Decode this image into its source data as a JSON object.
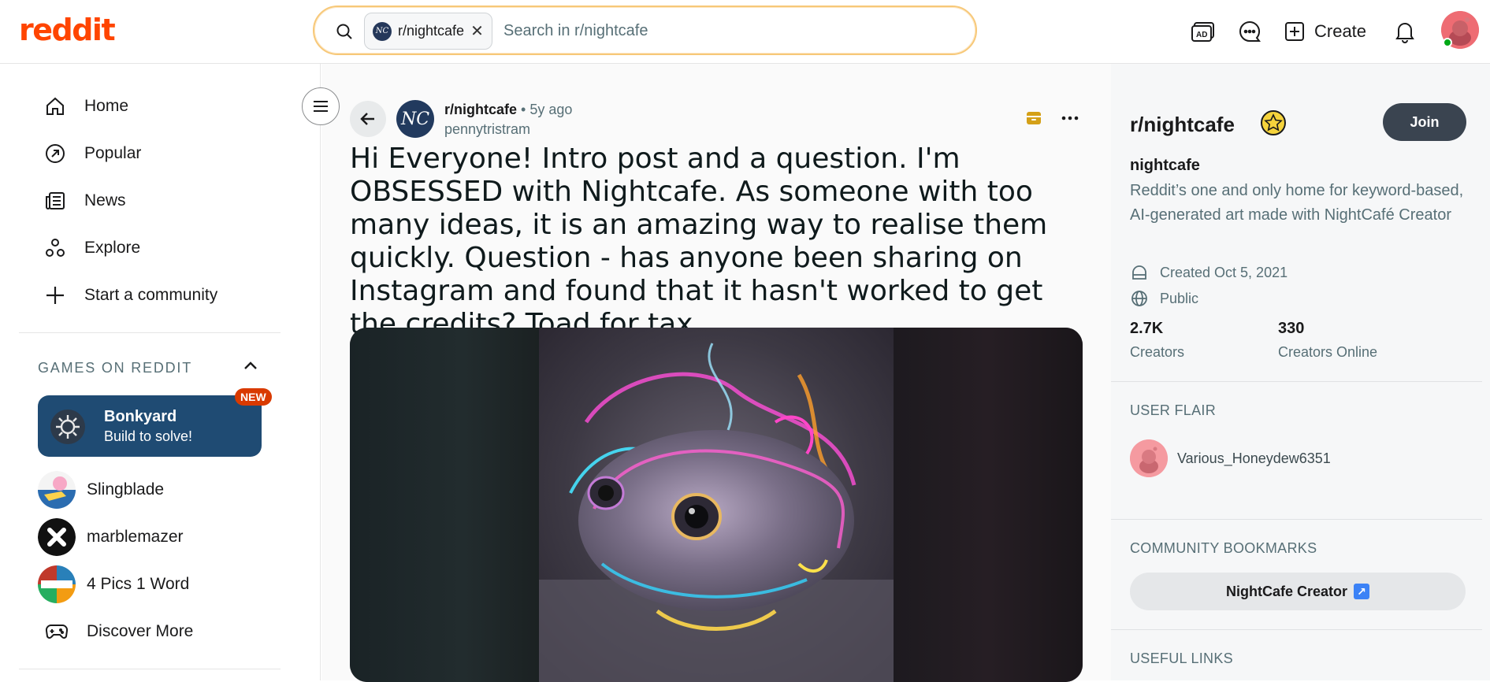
{
  "header": {
    "logo": "reddit",
    "search": {
      "chip_label": "r/nightcafe",
      "chip_avatar": "NC",
      "placeholder": "Search in r/nightcafe"
    },
    "create_label": "Create"
  },
  "sidebar": {
    "nav": [
      {
        "label": "Home",
        "icon": "home-icon"
      },
      {
        "label": "Popular",
        "icon": "popular-icon"
      },
      {
        "label": "News",
        "icon": "news-icon"
      },
      {
        "label": "Explore",
        "icon": "explore-icon"
      },
      {
        "label": "Start a community",
        "icon": "plus-icon"
      }
    ],
    "games_title": "GAMES ON REDDIT",
    "featured_game": {
      "name": "Bonkyard",
      "subtitle": "Build to solve!",
      "badge": "NEW"
    },
    "games": [
      {
        "label": "Slingblade"
      },
      {
        "label": "marblemazer"
      },
      {
        "label": "4 Pics 1 Word"
      },
      {
        "label": "Discover More"
      }
    ]
  },
  "post": {
    "subreddit": "r/nightcafe",
    "separator": "•",
    "age": "5y ago",
    "author": "pennytristram",
    "avatar": "NC",
    "title": "Hi Everyone! Intro post and a question. I'm OBSESSED with Nightcafe. As someone with too many ideas, it is an amazing way to realise them quickly. Question - has anyone been sharing on Instagram and found that it hasn't worked to get the credits? Toad for tax."
  },
  "community": {
    "title": "r/nightcafe",
    "join_label": "Join",
    "name": "nightcafe",
    "description": "Reddit’s one and only home for keyword-based, AI-generated art made with NightCafé Creator",
    "created": "Created Oct 5, 2021",
    "visibility": "Public",
    "stats": [
      {
        "value": "2.7K",
        "label": "Creators"
      },
      {
        "value": "330",
        "label": "Creators Online"
      }
    ],
    "user_flair_title": "USER FLAIR",
    "user_flair_name": "Various_Honeydew6351",
    "bookmarks_title": "COMMUNITY BOOKMARKS",
    "bookmark_label": "NightCafe Creator",
    "useful_links_title": "USEFUL LINKS"
  },
  "colors": {
    "brand": "#ff4500",
    "join": "#3a4450",
    "featured_game_bg": "#1f4b73",
    "online": "#01a816"
  }
}
